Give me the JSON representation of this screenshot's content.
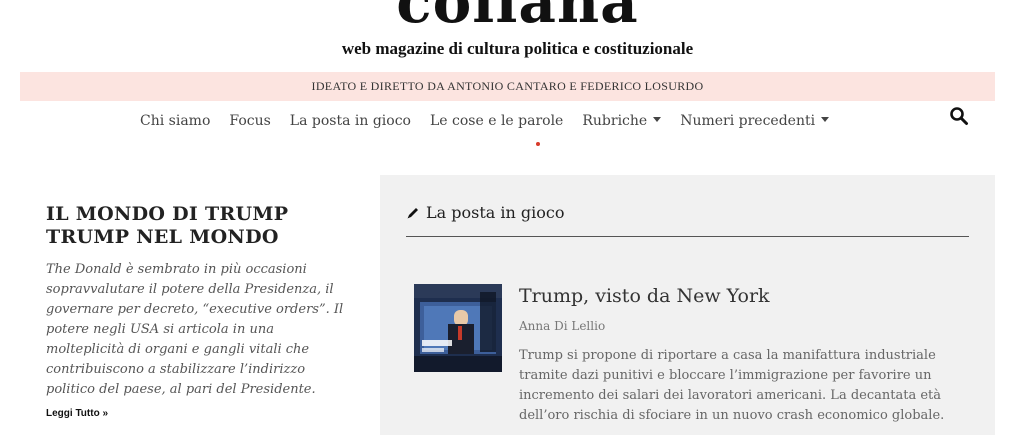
{
  "site": {
    "logo": "collana",
    "tagline": "web magazine di cultura politica e costituzionale",
    "banner": "IDEATO E DIRETTO DA ANTONIO CANTARO E FEDERICO LOSURDO"
  },
  "nav": {
    "items": [
      {
        "label": "Chi siamo"
      },
      {
        "label": "Focus"
      },
      {
        "label": "La posta in gioco"
      },
      {
        "label": "Le cose e le parole"
      },
      {
        "label": "Rubriche"
      },
      {
        "label": "Numeri precedenti"
      }
    ],
    "search_icon": "search-icon"
  },
  "feature": {
    "title": "IL MONDO DI TRUMP TRUMP NEL MONDO",
    "excerpt": "The Donald è sembrato in più occasioni sopravvalutare il potere della Presidenza, il governare per decreto, “executive orders”. Il potere negli USA si articola in una molteplicità di organi e gangli vitali che contribuiscono a stabilizzare l’indirizzo politico del paese, al pari del Presidente.",
    "read_more": "Leggi Tutto »"
  },
  "section": {
    "title": "La posta in gioco",
    "icon": "pen-icon"
  },
  "article": {
    "title": "Trump, visto da New York",
    "author": "Anna Di Lellio",
    "excerpt": "Trump si propone di riportare a casa la manifattura industriale tramite dazi punitivi e bloccare l’immigrazione per favorire un incremento dei salari dei lavoratori americani. La decantata età dell’oro rischia di sfociare in un nuovo crash economico globale."
  },
  "colors": {
    "banner_bg": "#fce4e0",
    "panel_bg": "#f1f1f1",
    "accent_dot": "#d83a2a"
  }
}
